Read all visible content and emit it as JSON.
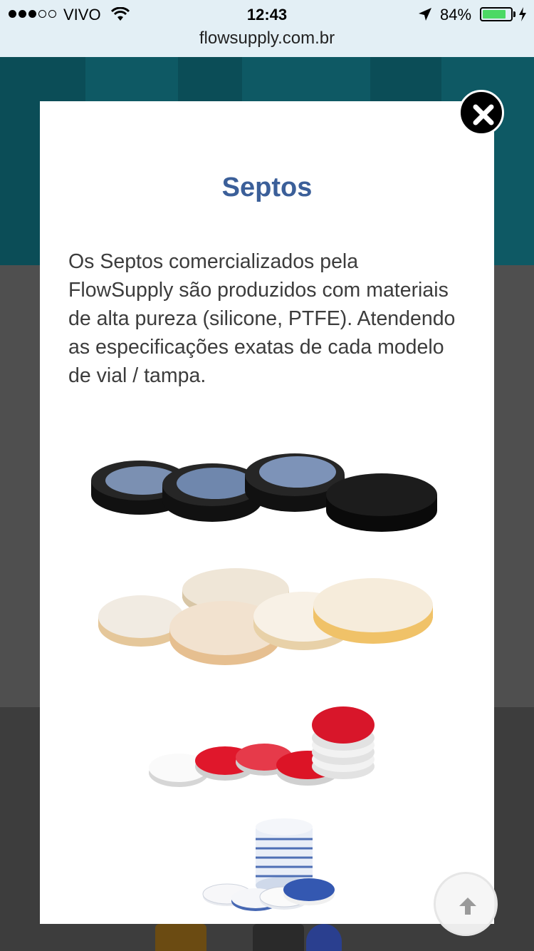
{
  "status_bar": {
    "carrier": "VIVO",
    "time": "12:43",
    "battery_percent": "84%",
    "battery_level": 0.84,
    "signal_icon": "signal-dots-icon",
    "wifi_icon": "wifi-icon",
    "location_icon": "location-arrow-icon",
    "charging_icon": "bolt-icon"
  },
  "browser": {
    "url": "flowsupply.com.br"
  },
  "modal": {
    "title": "Septos",
    "description": "Os Septos comercializados pela FlowSupply são produzidos com materiais de alta pureza (silicone, PTFE). Atendendo as especificações exatas de cada modelo de vial / tampa.",
    "close_icon": "close-icon",
    "images": [
      "black-septa-blue-face",
      "beige-silicone-septa",
      "red-white-ptfe-septa",
      "blue-white-septa-stack"
    ]
  },
  "scroll_top": {
    "icon": "arrow-up-icon"
  },
  "colors": {
    "title": "#3b5f99",
    "status_bar_bg": "#e3eff5",
    "hero_bg": "#0e5964",
    "battery": "#4cd964"
  }
}
